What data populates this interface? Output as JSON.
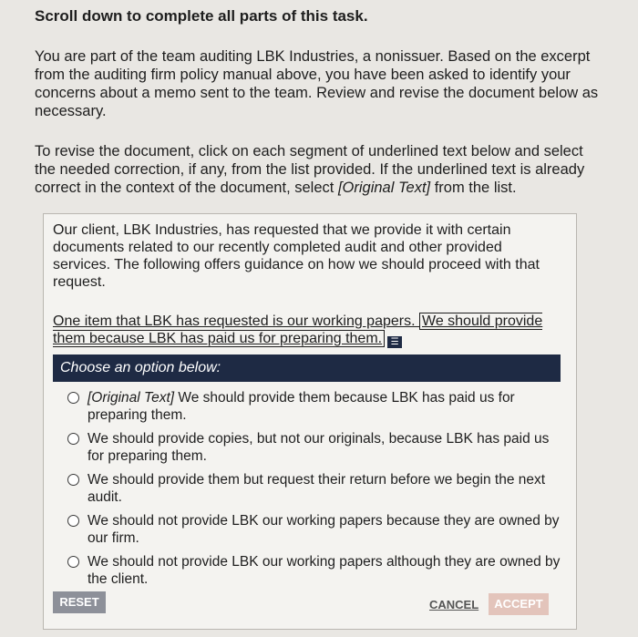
{
  "instructions": {
    "heading": "Scroll down to complete all parts of this task.",
    "paragraph1": "You are part of the team auditing LBK Industries, a nonissuer. Based on the excerpt from the auditing firm policy manual above, you have been asked to identify your concerns about a memo sent to the team. Review and revise the document below as necessary.",
    "paragraph2_start": "To revise the document, click on each segment of underlined text below and select the needed correction, if any, from the list provided. If the underlined text is already correct in the context of the document, select ",
    "paragraph2_italic": "[Original Text]",
    "paragraph2_end": " from the list."
  },
  "document": {
    "paragraph1": "Our client, LBK Industries, has requested that we provide it with certain documents related to our recently completed audit and other provided services. The following offers guidance on how we should proceed with that request.",
    "paragraph2_start": "One item that LBK has requested is our working papers. ",
    "selected_segment": "We should provide them because LBK has paid us for preparing them.",
    "edit_icon": "list-edit-icon"
  },
  "dropdown": {
    "header": "Choose an option below:",
    "options": [
      {
        "prefix": "[Original Text]",
        "text": " We should provide them because LBK has paid us for preparing them."
      },
      {
        "prefix": "",
        "text": "We should provide copies, but not our originals, because LBK has paid us for preparing them."
      },
      {
        "prefix": "",
        "text": "We should provide them but request their return before we begin the next audit."
      },
      {
        "prefix": "",
        "text": "We should not provide LBK our working papers because they are owned by our firm."
      },
      {
        "prefix": "",
        "text": "We should not provide LBK our working papers although they are owned by the client."
      }
    ]
  },
  "buttons": {
    "reset": "RESET",
    "cancel": "CANCEL",
    "accept": "ACCEPT"
  },
  "colors": {
    "header_bg": "#1e2a44",
    "reset_bg": "#8d9099",
    "accept_bg": "#e3c4bb"
  }
}
